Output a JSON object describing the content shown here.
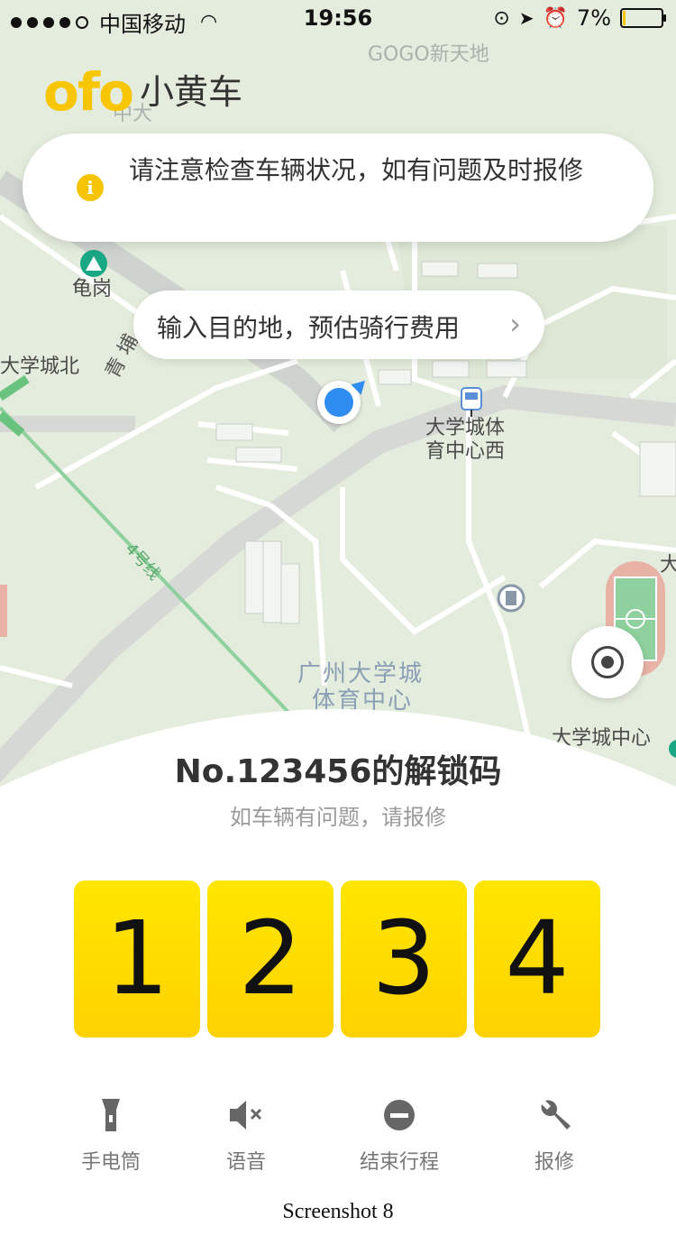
{
  "status_bar": {
    "carrier": "中国移动",
    "time": "19:56",
    "battery": "7%",
    "battery_level": 0.07
  },
  "logo": {
    "brand": "ofo",
    "name": "小黄车"
  },
  "notice": {
    "text": "请注意检查车辆状况，如有问题及时报修"
  },
  "destination": {
    "placeholder": "输入目的地，预估骑行费用"
  },
  "map": {
    "labels": {
      "gogo": "GOGO新天地",
      "zhongda": "中大",
      "guigang": "龟岗",
      "daxuecheng_bei": "大学城北",
      "qinggang": "青 埔",
      "tiyu_xi": "大学城体育中心西",
      "line4": "4号线",
      "guangzhou_daxuecheng": "广州大学城",
      "tiyu_zhongxin": "体育中心",
      "zhongxin_guangchang": "大学城中心广场",
      "da": "大"
    }
  },
  "unlock": {
    "title": "No.123456的解锁码",
    "subtitle": "如车辆有问题，请报修",
    "digits": [
      "1",
      "2",
      "3",
      "4"
    ]
  },
  "tools": [
    {
      "label": "手电筒",
      "icon": "flashlight-icon"
    },
    {
      "label": "语音",
      "icon": "speaker-mute-icon"
    },
    {
      "label": "结束行程",
      "icon": "end-trip-icon"
    },
    {
      "label": "报修",
      "icon": "wrench-icon"
    }
  ],
  "caption": "Screenshot 8",
  "colors": {
    "brand_yellow": "#ffd600",
    "map_bg": "#e4ecdd",
    "location_blue": "#2f8cf0"
  }
}
